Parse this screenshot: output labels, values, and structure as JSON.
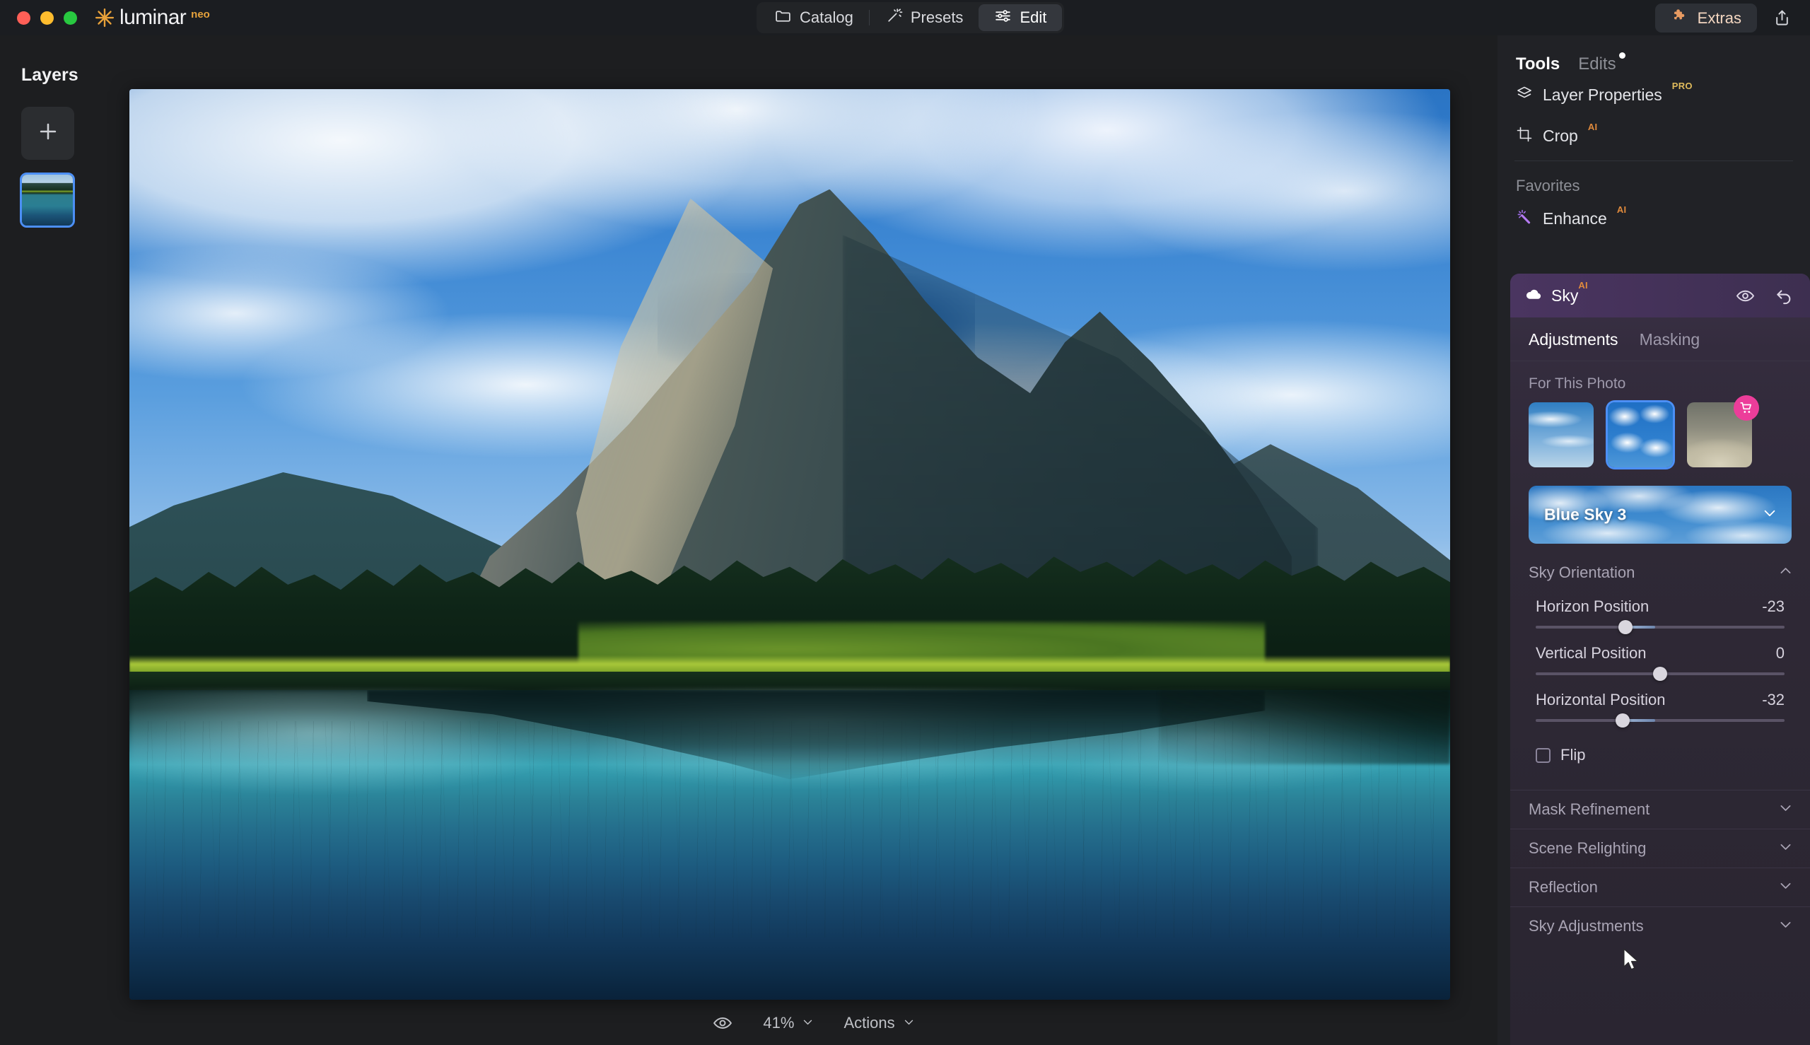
{
  "titlebar": {
    "brand_name": "luminar",
    "brand_sup": "neo",
    "star_icon": "asterisk-star-icon",
    "traffic": {
      "close": "close-window-button",
      "minimize": "minimize-window-button",
      "zoom": "zoom-window-button"
    },
    "tabs": [
      {
        "label": "Catalog",
        "icon": "folder-icon",
        "active": false
      },
      {
        "label": "Presets",
        "icon": "magic-wand-icon",
        "active": false
      },
      {
        "label": "Edit",
        "icon": "sliders-icon",
        "active": true
      }
    ],
    "extras": {
      "label": "Extras",
      "icon": "puzzle-piece-icon"
    },
    "share": {
      "icon": "share-export-icon"
    }
  },
  "layers": {
    "title": "Layers",
    "add_icon": "plus-icon",
    "thumbnail_name": "layer-thumbnail"
  },
  "canvas": {
    "photo_alt": "mountain-lake-reflection-photo"
  },
  "bottombar": {
    "preview_icon": "eye-icon",
    "zoom_value": "41%",
    "zoom_chevron": "chevron-down-icon",
    "actions_label": "Actions",
    "actions_chevron": "chevron-down-icon"
  },
  "right_panel": {
    "tools_label": "Tools",
    "edits_label": "Edits",
    "tools": [
      {
        "label": "Layer Properties",
        "badge": "PRO",
        "icon": "layers-stack-icon"
      },
      {
        "label": "Crop",
        "badge": "AI",
        "icon": "crop-icon"
      }
    ],
    "favorites_label": "Favorites",
    "favorites": [
      {
        "label": "Enhance",
        "badge": "AI",
        "icon": "enhance-sparkle-icon"
      }
    ],
    "sky_tool": {
      "title": "Sky",
      "badge": "AI",
      "icon": "cloud-icon",
      "visibility_icon": "eye-icon",
      "reset_icon": "undo-arrow-icon",
      "tabs": [
        {
          "label": "Adjustments",
          "active": true
        },
        {
          "label": "Masking",
          "active": false
        }
      ],
      "for_this_photo_label": "For This Photo",
      "thumbnails": [
        {
          "name": "sky-preset-cirrus",
          "selected": false,
          "premium": false
        },
        {
          "name": "sky-preset-cumulus",
          "selected": true,
          "premium": false
        },
        {
          "name": "sky-preset-sunset",
          "selected": false,
          "premium": true,
          "badge_icon": "shopping-cart-icon"
        }
      ],
      "selected_sky": "Blue Sky 3",
      "selected_sky_chevron": "chevron-down-icon",
      "orientation": {
        "title": "Sky Orientation",
        "chevron": "chevron-up-icon",
        "expanded": true,
        "sliders": [
          {
            "label": "Horizon Position",
            "value": "-23",
            "percent": 36
          },
          {
            "label": "Vertical Position",
            "value": "0",
            "percent": 50
          },
          {
            "label": "Horizontal Position",
            "value": "-32",
            "percent": 35
          }
        ],
        "flip": {
          "label": "Flip",
          "checked": false
        }
      },
      "collapsed_sections": [
        {
          "label": "Mask Refinement",
          "chevron": "chevron-down-icon"
        },
        {
          "label": "Scene Relighting",
          "chevron": "chevron-down-icon"
        },
        {
          "label": "Reflection",
          "chevron": "chevron-down-icon"
        },
        {
          "label": "Sky Adjustments",
          "chevron": "chevron-down-icon"
        }
      ]
    }
  },
  "colors": {
    "accent_blue": "#4c8ff5",
    "badge_pro": "#e0bb5c",
    "badge_ai": "#e08a3c",
    "cart_pink": "#ec3d9a",
    "extras_orange": "#e89b62",
    "panel_bg": "#212226",
    "app_bg": "#1d1e20"
  }
}
